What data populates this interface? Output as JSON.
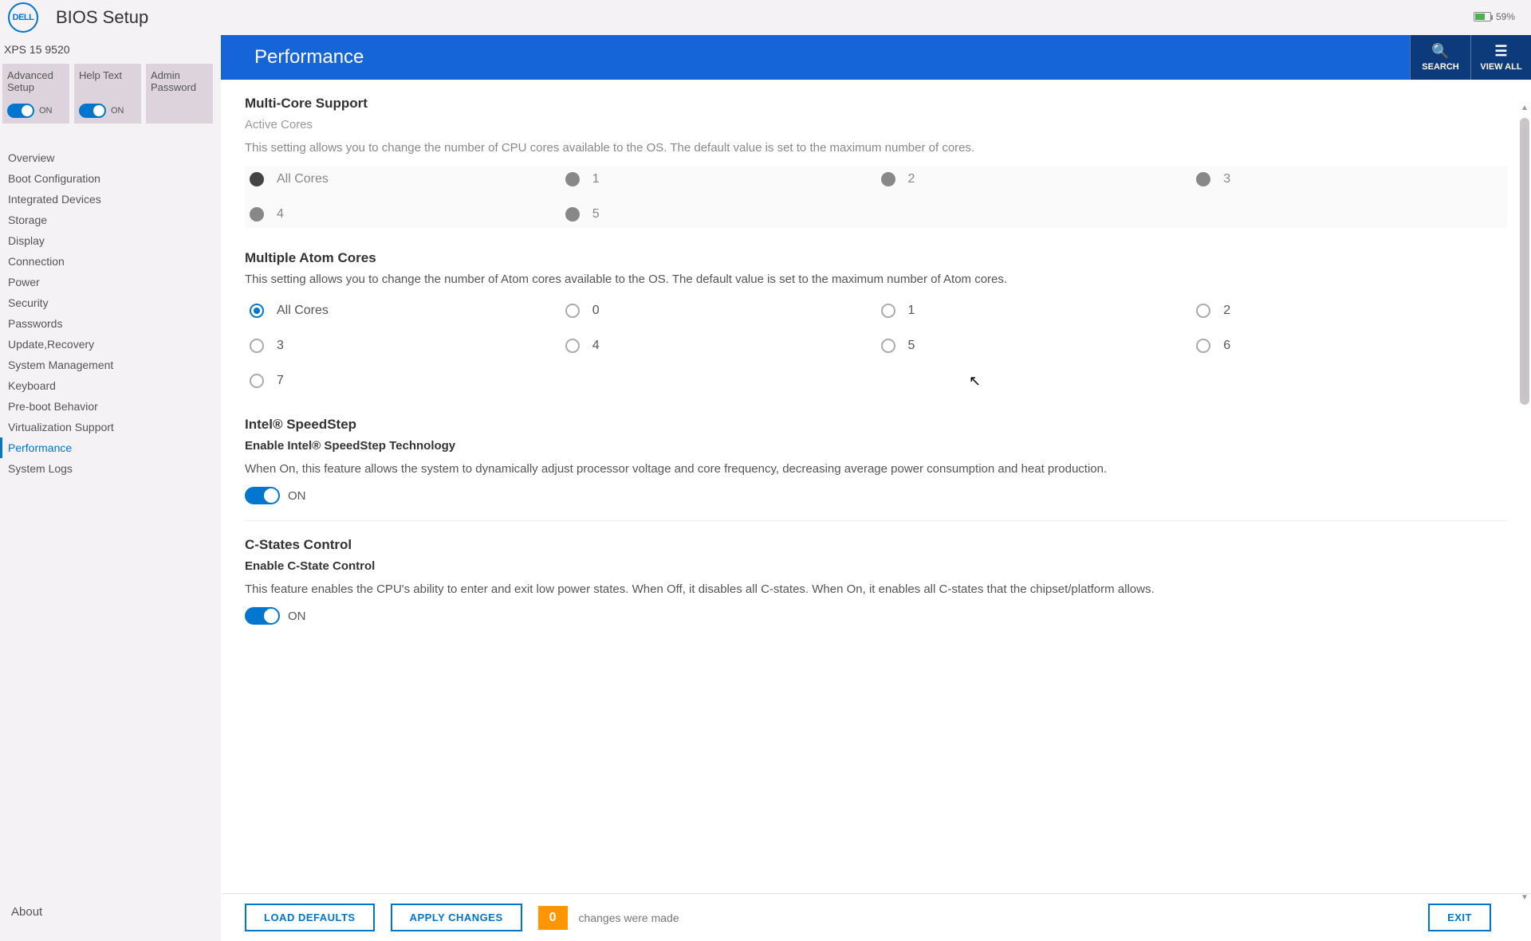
{
  "top": {
    "title": "BIOS Setup",
    "battery": "59%"
  },
  "model": "XPS 15 9520",
  "cards": [
    {
      "label": "Advanced Setup",
      "state": "ON"
    },
    {
      "label": "Help Text",
      "state": "ON"
    },
    {
      "label": "Admin Password",
      "state": ""
    }
  ],
  "nav": [
    "Overview",
    "Boot Configuration",
    "Integrated Devices",
    "Storage",
    "Display",
    "Connection",
    "Power",
    "Security",
    "Passwords",
    "Update,Recovery",
    "System Management",
    "Keyboard",
    "Pre-boot Behavior",
    "Virtualization Support",
    "Performance",
    "System Logs"
  ],
  "nav_active": "Performance",
  "about": "About",
  "header": {
    "title": "Performance",
    "search": "SEARCH",
    "viewall": "VIEW ALL"
  },
  "sections": {
    "multicore": {
      "title": "Multi-Core Support",
      "sub": "Active Cores",
      "desc": "This setting allows you to change the number of CPU cores available to the OS. The default value is set to the maximum number of cores.",
      "options": [
        "All Cores",
        "1",
        "2",
        "3",
        "4",
        "5"
      ],
      "selected": "All Cores"
    },
    "atom": {
      "title": "Multiple Atom Cores",
      "desc": "This setting allows you to change the number of Atom cores available to the OS. The default value is set to the maximum number of Atom cores.",
      "options": [
        "All Cores",
        "0",
        "1",
        "2",
        "3",
        "4",
        "5",
        "6",
        "7"
      ],
      "selected": "All Cores"
    },
    "speedstep": {
      "title": "Intel® SpeedStep",
      "sub": "Enable Intel® SpeedStep Technology",
      "desc": "When On, this feature allows the system to dynamically adjust processor voltage and core frequency, decreasing average power consumption and heat production.",
      "state": "ON"
    },
    "cstates": {
      "title": "C-States Control",
      "sub": "Enable C-State Control",
      "desc": "This feature enables the CPU's ability to enter and exit low power states. When Off, it disables all C-states. When On, it enables all C-states that the chipset/platform allows.",
      "state": "ON"
    }
  },
  "footer": {
    "load": "LOAD DEFAULTS",
    "apply": "APPLY CHANGES",
    "count": "0",
    "text": "changes were made",
    "exit": "EXIT"
  }
}
